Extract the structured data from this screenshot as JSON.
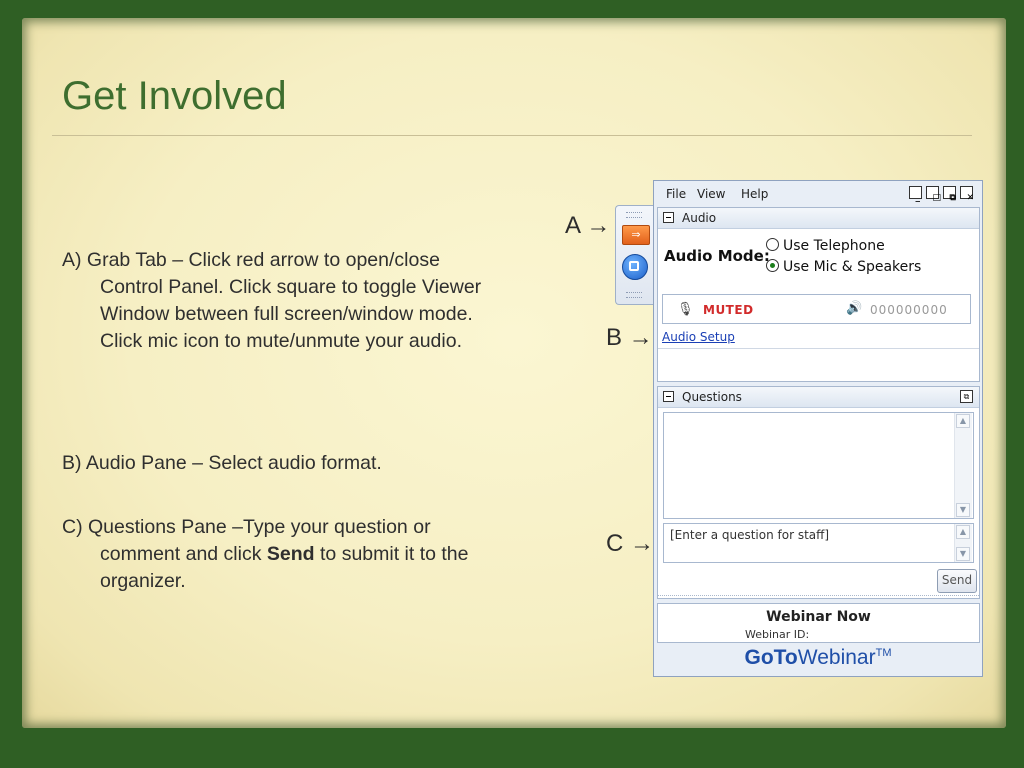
{
  "slide": {
    "title": "Get Involved",
    "items": [
      {
        "lead": "A) Grab Tab – Click red arrow to",
        "rest": "open/close Control Panel. Click square to toggle Viewer Window between full screen/window mode. Click mic icon to mute/unmute your audio."
      },
      {
        "lead": "B) Audio Pane – Select audio format.",
        "rest": ""
      },
      {
        "lead": "C) Questions Pane –Type your question",
        "rest_before": "or comment and click ",
        "bold": "Send",
        "rest_after": " to submit it to the organizer."
      }
    ],
    "pointer_a": "A →",
    "pointer_b": "B →",
    "pointer_c": "C →"
  },
  "panel": {
    "menu": {
      "file": "File",
      "view": "View",
      "help": "Help"
    },
    "audio": {
      "header": "Audio",
      "mode_label": "Audio Mode:",
      "option_telephone": "Use Telephone",
      "option_mic": "Use Mic & Speakers",
      "selected": "Use Mic & Speakers",
      "status": "MUTED",
      "meter": "000000000",
      "setup_link": "Audio Setup"
    },
    "questions": {
      "header": "Questions",
      "placeholder": "[Enter a question for staff]",
      "send_label": "Send"
    },
    "webinar": {
      "title": "Webinar Now",
      "id_label": "Webinar ID:"
    },
    "brand": {
      "goto": "GoTo",
      "webinar": "Webinar",
      "tm": "TM"
    }
  }
}
